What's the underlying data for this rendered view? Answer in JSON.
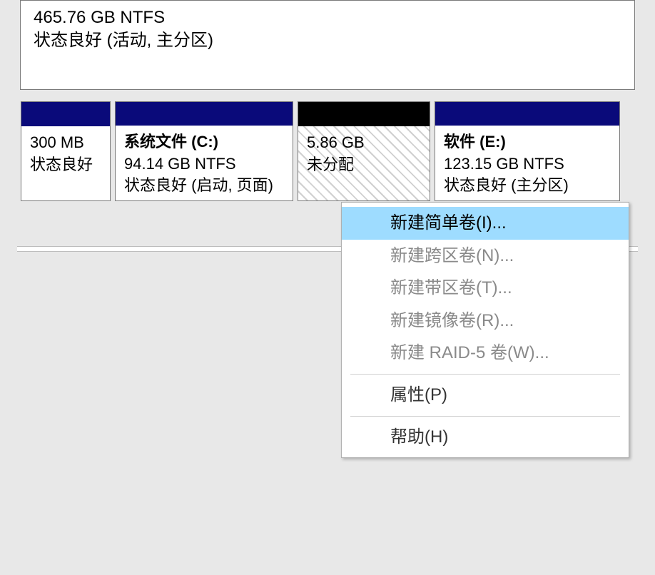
{
  "topVolume": {
    "sizeLine": "465.76 GB NTFS",
    "statusLine": "状态良好 (活动, 主分区)"
  },
  "partitions": {
    "p0": {
      "size": "300 MB",
      "status": "状态良好"
    },
    "p1": {
      "title": "系统文件  (C:)",
      "size": "94.14 GB NTFS",
      "status": "状态良好 (启动, 页面)"
    },
    "p2": {
      "size": "5.86 GB",
      "status": "未分配"
    },
    "p3": {
      "title": "软件  (E:)",
      "size": "123.15 GB NTFS",
      "status": "状态良好 (主分区)"
    }
  },
  "contextMenu": {
    "newSimpleVolume": "新建简单卷(I)...",
    "newSpannedVolume": "新建跨区卷(N)...",
    "newStripedVolume": "新建带区卷(T)...",
    "newMirroredVolume": "新建镜像卷(R)...",
    "newRaid5Volume": "新建 RAID-5 卷(W)...",
    "properties": "属性(P)",
    "help": "帮助(H)"
  }
}
